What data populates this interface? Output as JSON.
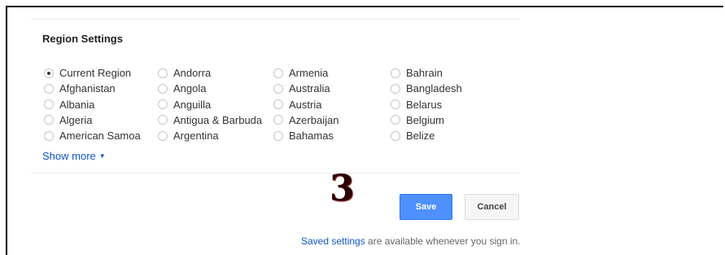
{
  "section": {
    "title": "Region Settings"
  },
  "regions": {
    "columns": [
      [
        {
          "label": "Current Region",
          "checked": true
        },
        {
          "label": "Afghanistan",
          "checked": false
        },
        {
          "label": "Albania",
          "checked": false
        },
        {
          "label": "Algeria",
          "checked": false
        },
        {
          "label": "American Samoa",
          "checked": false
        }
      ],
      [
        {
          "label": "Andorra",
          "checked": false
        },
        {
          "label": "Angola",
          "checked": false
        },
        {
          "label": "Anguilla",
          "checked": false
        },
        {
          "label": "Antigua & Barbuda",
          "checked": false
        },
        {
          "label": "Argentina",
          "checked": false
        }
      ],
      [
        {
          "label": "Armenia",
          "checked": false
        },
        {
          "label": "Australia",
          "checked": false
        },
        {
          "label": "Austria",
          "checked": false
        },
        {
          "label": "Azerbaijan",
          "checked": false
        },
        {
          "label": "Bahamas",
          "checked": false
        }
      ],
      [
        {
          "label": "Bahrain",
          "checked": false
        },
        {
          "label": "Bangladesh",
          "checked": false
        },
        {
          "label": "Belarus",
          "checked": false
        },
        {
          "label": "Belgium",
          "checked": false
        },
        {
          "label": "Belize",
          "checked": false
        }
      ]
    ]
  },
  "show_more": {
    "label": "Show more",
    "icon": "caret-down-icon"
  },
  "annotation": {
    "text": "3"
  },
  "buttons": {
    "save": "Save",
    "cancel": "Cancel"
  },
  "footer": {
    "link_text": "Saved settings",
    "rest_text": " are available whenever you sign in."
  },
  "colors": {
    "primary": "#4d90fe",
    "link": "#1155cc"
  }
}
